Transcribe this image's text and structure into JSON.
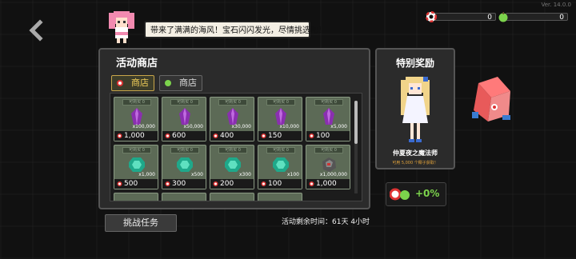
{
  "version": "Ver. 14.0.0",
  "npc_speech": "带来了满满的海风！宝石闪闪发光，尽情挑选吧！",
  "currencies": [
    {
      "icon": "lifebuoy-icon",
      "value": "0"
    },
    {
      "icon": "green-apple-icon",
      "value": "0"
    }
  ],
  "shop": {
    "title": "活动商店",
    "tabs": [
      {
        "label": "商店",
        "icon": "lifebuoy-icon"
      },
      {
        "label": "商店",
        "icon": "green-apple-icon"
      }
    ],
    "items": [
      {
        "tag": "可购买 0",
        "gem": "purple-crystal",
        "qty": "x100,000",
        "price": "1,000"
      },
      {
        "tag": "可购买 0",
        "gem": "purple-crystal",
        "qty": "x50,000",
        "price": "600"
      },
      {
        "tag": "可购买 0",
        "gem": "purple-crystal",
        "qty": "x30,000",
        "price": "400"
      },
      {
        "tag": "可购买 0",
        "gem": "purple-crystal",
        "qty": "x10,000",
        "price": "150"
      },
      {
        "tag": "可购买 0",
        "gem": "purple-crystal",
        "qty": "x5,000",
        "price": "100"
      },
      {
        "tag": "可购买 0",
        "gem": "teal-gem",
        "qty": "x1,000",
        "price": "500"
      },
      {
        "tag": "可购买 0",
        "gem": "teal-gem",
        "qty": "x500",
        "price": "300"
      },
      {
        "tag": "可购买 0",
        "gem": "teal-gem",
        "qty": "x300",
        "price": "200"
      },
      {
        "tag": "可购买 0",
        "gem": "teal-gem",
        "qty": "x100",
        "price": "100"
      },
      {
        "tag": "可购买 0",
        "gem": "dark-ore",
        "qty": "x1,000,000",
        "price": "1,000"
      }
    ]
  },
  "reward": {
    "title": "特别奖励",
    "name": "仲夏夜之魔法师",
    "subtitle": "可用 5,000 个椰子获取！"
  },
  "bonus": {
    "value": "+0%",
    "icon": "green-apple-icon"
  },
  "challenge_button": "挑战任务",
  "time_left": "活动剩余时间：61天 4小时",
  "colors": {
    "accent": "#f2cf5a",
    "bonus_green": "#7cd34c",
    "item_bg": "#5c6a56",
    "reward_subtitle": "#e0a23a"
  }
}
